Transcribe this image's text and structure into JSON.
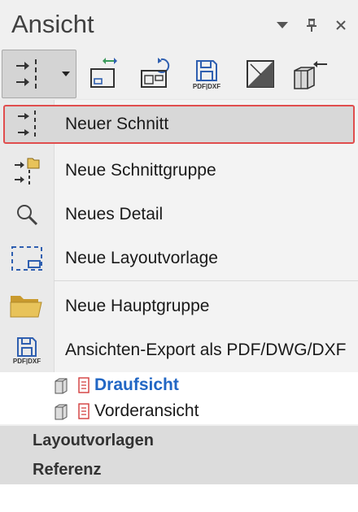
{
  "panel": {
    "title": "Ansicht",
    "controls": {
      "dropdown": "▾",
      "pin": "📌",
      "close": "✕"
    }
  },
  "toolbar": {
    "buttons": [
      {
        "name": "new-section",
        "icon": "section-arrows-icon"
      },
      {
        "name": "add-layout",
        "icon": "layout-swap-icon"
      },
      {
        "name": "refresh-layout",
        "icon": "layout-refresh-icon"
      },
      {
        "name": "export-pdf-dxf",
        "icon": "save-pdf-dxf-icon",
        "label": "PDF|DXF"
      },
      {
        "name": "shading",
        "icon": "shading-icon"
      },
      {
        "name": "3d-view",
        "icon": "3d-view-icon"
      }
    ]
  },
  "menu": {
    "items": [
      {
        "label": "Neuer Schnitt",
        "icon": "section-arrows-icon",
        "highlighted": true
      },
      {
        "label": "Neue Schnittgruppe",
        "icon": "section-group-icon"
      },
      {
        "label": "Neues Detail",
        "icon": "magnifier-icon"
      },
      {
        "label": "Neue Layoutvorlage",
        "icon": "layout-template-icon"
      },
      {
        "label": "Neue Hauptgruppe",
        "icon": "folder-icon"
      },
      {
        "label": "Ansichten-Export als PDF/DWG/DXF",
        "icon": "save-pdf-dxf-icon",
        "icon_label": "PDF|DXF"
      }
    ]
  },
  "tree": {
    "items": [
      {
        "label": "Draufsicht",
        "selected": true
      },
      {
        "label": "Vorderansicht",
        "selected": false
      }
    ]
  },
  "groups": [
    {
      "label": "Layoutvorlagen"
    },
    {
      "label": "Referenz"
    }
  ],
  "colors": {
    "highlight_border": "#e04d4d",
    "selected_text": "#2166c4",
    "icon_blue": "#2f5fb0",
    "icon_green": "#3a9a5a",
    "icon_red": "#d23c3c",
    "folder_yellow": "#e8c35a"
  }
}
